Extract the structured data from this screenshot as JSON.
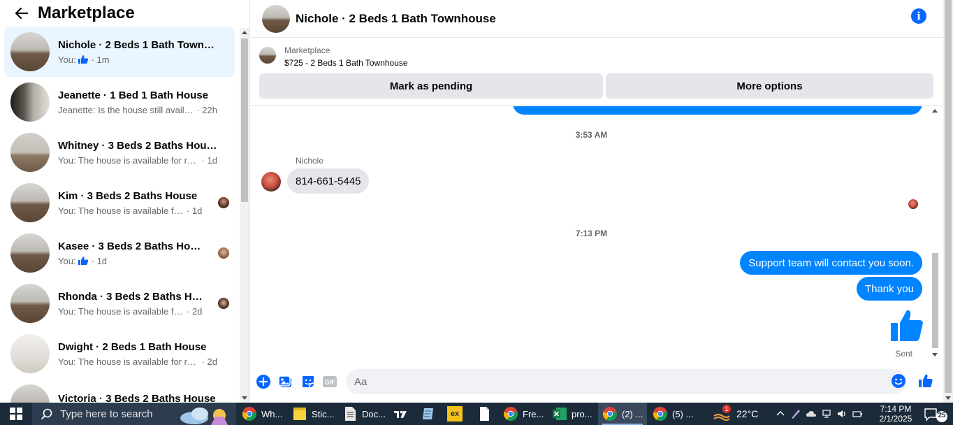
{
  "left_panel": {
    "title": "Marketplace",
    "conversations": [
      {
        "name": "Nichole · 2 Beds 1 Bath Townho...",
        "preview_prefix": "You:",
        "preview": "",
        "time": "· 1m",
        "has_like": true,
        "active": true
      },
      {
        "name": "Jeanette · 1 Bed 1 Bath House",
        "preview_prefix": "",
        "preview": "Jeanette: Is the house still available",
        "time": "· 22h",
        "has_like": false,
        "active": false
      },
      {
        "name": "Whitney · 3 Beds 2 Baths House",
        "preview_prefix": "",
        "preview": "You: The house is available for rent,...",
        "time": "· 1d",
        "has_like": false,
        "active": false
      },
      {
        "name": "Kim · 3 Beds 2 Baths House",
        "preview_prefix": "",
        "preview": "You: The house is available for r...",
        "time": "· 1d",
        "has_like": false,
        "active": false
      },
      {
        "name": "Kasee · 3 Beds 2 Baths House",
        "preview_prefix": "You:",
        "preview": "",
        "time": "· 1d",
        "has_like": true,
        "active": false
      },
      {
        "name": "Rhonda · 3 Beds 2 Baths House",
        "preview_prefix": "",
        "preview": "You: The house is available for r...",
        "time": "· 2d",
        "has_like": false,
        "active": false
      },
      {
        "name": "Dwight · 2 Beds 1 Bath House",
        "preview_prefix": "",
        "preview": "You: The house is available for rent,...",
        "time": "· 2d",
        "has_like": false,
        "active": false
      },
      {
        "name": "Victoria · 3 Beds 2 Baths House",
        "preview_prefix": "",
        "preview": "",
        "time": "",
        "has_like": false,
        "active": false
      }
    ]
  },
  "chat": {
    "title": "Nichole · 2 Beds 1 Bath Townhouse",
    "listing": {
      "source": "Marketplace",
      "price_title": "$725 - 2 Beds 1 Bath Townhouse",
      "pending_button": "Mark as pending",
      "more_button": "More options"
    },
    "timestamp_1": "3:53 AM",
    "sender_name": "Nichole",
    "incoming_message": "814-661-5445",
    "timestamp_2": "7:13 PM",
    "outgoing_message_1": "Support team will contact you soon.",
    "outgoing_message_2": "Thank you",
    "sent_status": "Sent",
    "composer_placeholder": "Aa",
    "gif_label": "GIF"
  },
  "taskbar": {
    "search_placeholder": "Type here to search",
    "apps": [
      {
        "label": "Wh...",
        "icon": "chrome-icon",
        "active": false
      },
      {
        "label": "Stic...",
        "icon": "sticky-notes-icon",
        "active": false
      },
      {
        "label": "Doc...",
        "icon": "document-icon",
        "active": false
      },
      {
        "label": "",
        "icon": "tradingview-icon",
        "active": false
      },
      {
        "label": "",
        "icon": "notepad-icon",
        "active": false
      },
      {
        "label": "",
        "icon": "ex-app-icon",
        "active": false
      },
      {
        "label": "",
        "icon": "file-icon",
        "active": false
      },
      {
        "label": "Fre...",
        "icon": "chrome-icon",
        "active": false
      },
      {
        "label": "pro...",
        "icon": "excel-icon",
        "active": false
      },
      {
        "label": "(2) ...",
        "icon": "chrome-icon",
        "active": true
      },
      {
        "label": "(5) ...",
        "icon": "chrome-icon",
        "active": false
      }
    ],
    "ex_icon_text": "ex",
    "weather_badge": "1",
    "temperature": "22°C",
    "time": "7:14 PM",
    "date": "2/1/2025",
    "notification_count": "25"
  },
  "colors": {
    "messenger_blue": "#0084ff",
    "accent_blue": "#0866ff",
    "active_row": "#ebf5ff",
    "button_gray": "#e4e6eb",
    "taskbar": "#1c2b3a"
  }
}
